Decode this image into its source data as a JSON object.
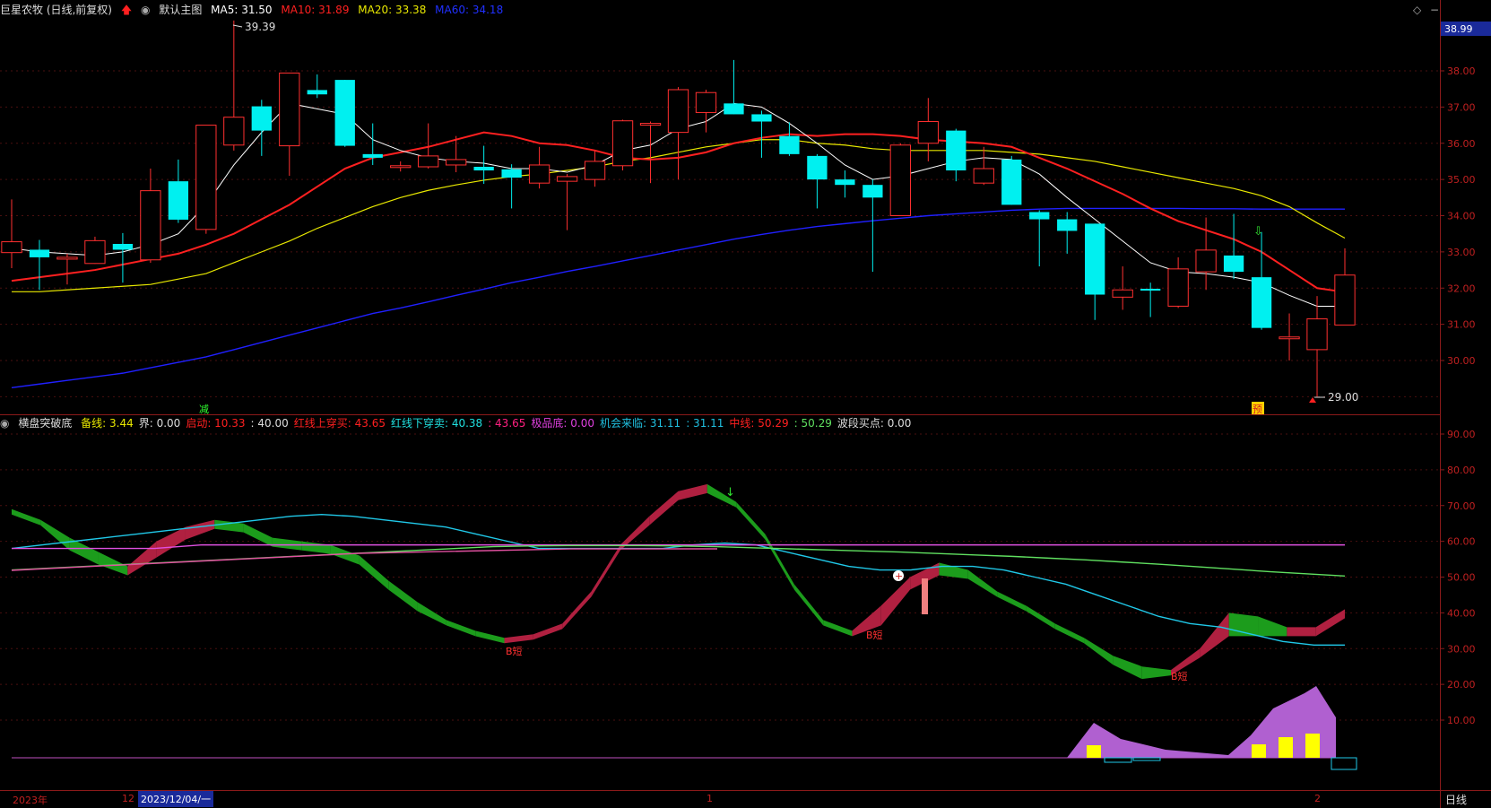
{
  "header": {
    "stock_name": "巨星农牧 (日线,前复权)",
    "up_arrow": "arrow-up-icon",
    "main_chart_label": "默认主图",
    "ma5": "MA5: 31.50",
    "ma10": "MA10: 31.89",
    "ma20": "MA20: 33.38",
    "ma60": "MA60: 34.18",
    "colors": {
      "ma5": "#ffffff",
      "ma10": "#ff2020",
      "ma20": "#e8e800",
      "ma60": "#2020ff"
    }
  },
  "indicator_header": {
    "name": "横盘突破底",
    "items": [
      {
        "text": "备线: 3.44",
        "color": "#e8e800"
      },
      {
        "text": "界: 0.00",
        "color": "#dddddd"
      },
      {
        "text": "启动: 10.33",
        "color": "#ff2020"
      },
      {
        "text": ": 40.00",
        "color": "#dddddd"
      },
      {
        "text": "红线上穿买: 43.65",
        "color": "#ff2020"
      },
      {
        "text": "红线下穿卖: 40.38",
        "color": "#20e0e0"
      },
      {
        "text": ": 43.65",
        "color": "#ff2080"
      },
      {
        "text": "极品底: 0.00",
        "color": "#e040e0"
      },
      {
        "text": "机会来临: 31.11",
        "color": "#20c0e0"
      },
      {
        "text": ": 31.11",
        "color": "#20c0e0"
      },
      {
        "text": "中线: 50.29",
        "color": "#ff2020"
      },
      {
        "text": ": 50.29",
        "color": "#60e060"
      },
      {
        "text": "波段买点: 0.00",
        "color": "#dddddd"
      }
    ]
  },
  "price_axis": {
    "current_price": "38.99",
    "ticks": [
      "38.00",
      "37.00",
      "36.00",
      "35.00",
      "34.00",
      "33.00",
      "32.00",
      "31.00",
      "30.00"
    ]
  },
  "indicator_axis": {
    "ticks": [
      "90.00",
      "80.00",
      "70.00",
      "60.00",
      "50.00",
      "40.00",
      "30.00",
      "20.00",
      "10.00"
    ]
  },
  "annotations": {
    "high": "39.39",
    "low": "29.00",
    "mark_jian": "减",
    "mark_yu": "预",
    "b_short": "B短"
  },
  "bottom_bar": {
    "year": "2023年",
    "m12": "12",
    "date": "2023/12/04/一",
    "m1": "1",
    "m2": "2",
    "period": "日线"
  },
  "chart_data": {
    "type": "candlestick",
    "ylim": [
      29.0,
      39.39
    ],
    "candles": [
      {
        "o": 32.98,
        "h": 34.45,
        "l": 32.55,
        "c": 33.28
      },
      {
        "o": 33.06,
        "h": 33.33,
        "l": 31.95,
        "c": 32.85
      },
      {
        "o": 32.85,
        "h": 32.95,
        "l": 32.1,
        "c": 32.85
      },
      {
        "o": 32.68,
        "h": 33.42,
        "l": 32.67,
        "c": 33.31
      },
      {
        "o": 33.22,
        "h": 33.52,
        "l": 32.15,
        "c": 33.06
      },
      {
        "o": 32.78,
        "h": 35.3,
        "l": 32.7,
        "c": 34.69
      },
      {
        "o": 34.95,
        "h": 35.55,
        "l": 33.8,
        "c": 33.89
      },
      {
        "o": 33.62,
        "h": 36.5,
        "l": 33.5,
        "c": 36.5
      },
      {
        "o": 35.95,
        "h": 39.39,
        "l": 35.8,
        "c": 36.72
      },
      {
        "o": 37.02,
        "h": 37.2,
        "l": 35.65,
        "c": 36.35
      },
      {
        "o": 35.93,
        "h": 37.95,
        "l": 35.1,
        "c": 37.94
      },
      {
        "o": 37.47,
        "h": 37.9,
        "l": 37.25,
        "c": 37.35
      },
      {
        "o": 37.75,
        "h": 37.75,
        "l": 35.9,
        "c": 35.93
      },
      {
        "o": 35.7,
        "h": 36.55,
        "l": 35.4,
        "c": 35.6
      },
      {
        "o": 35.38,
        "h": 35.5,
        "l": 35.22,
        "c": 35.38
      },
      {
        "o": 35.35,
        "h": 36.55,
        "l": 35.3,
        "c": 35.65
      },
      {
        "o": 35.4,
        "h": 36.2,
        "l": 35.2,
        "c": 35.55
      },
      {
        "o": 35.35,
        "h": 35.93,
        "l": 34.88,
        "c": 35.25
      },
      {
        "o": 35.28,
        "h": 35.42,
        "l": 34.2,
        "c": 35.05
      },
      {
        "o": 34.9,
        "h": 35.9,
        "l": 34.75,
        "c": 35.4
      },
      {
        "o": 34.95,
        "h": 35.15,
        "l": 33.6,
        "c": 35.08
      },
      {
        "o": 35.0,
        "h": 35.8,
        "l": 34.8,
        "c": 35.5
      },
      {
        "o": 35.38,
        "h": 36.65,
        "l": 35.25,
        "c": 36.62
      },
      {
        "o": 36.5,
        "h": 36.6,
        "l": 34.9,
        "c": 36.55
      },
      {
        "o": 36.3,
        "h": 37.55,
        "l": 35.0,
        "c": 37.48
      },
      {
        "o": 36.85,
        "h": 37.48,
        "l": 36.3,
        "c": 37.4
      },
      {
        "o": 37.1,
        "h": 38.3,
        "l": 36.8,
        "c": 36.8
      },
      {
        "o": 36.8,
        "h": 36.9,
        "l": 35.6,
        "c": 36.6
      },
      {
        "o": 36.2,
        "h": 36.58,
        "l": 35.65,
        "c": 35.7
      },
      {
        "o": 35.65,
        "h": 35.7,
        "l": 34.2,
        "c": 35.0
      },
      {
        "o": 35.0,
        "h": 35.25,
        "l": 34.5,
        "c": 34.85
      },
      {
        "o": 34.85,
        "h": 35.0,
        "l": 32.45,
        "c": 34.5
      },
      {
        "o": 34.0,
        "h": 36.0,
        "l": 34.0,
        "c": 35.95
      },
      {
        "o": 36.0,
        "h": 37.25,
        "l": 35.5,
        "c": 36.6
      },
      {
        "o": 36.35,
        "h": 36.4,
        "l": 34.95,
        "c": 35.25
      },
      {
        "o": 34.9,
        "h": 35.9,
        "l": 34.85,
        "c": 35.3
      },
      {
        "o": 35.55,
        "h": 35.65,
        "l": 34.3,
        "c": 34.3
      },
      {
        "o": 34.1,
        "h": 34.15,
        "l": 32.6,
        "c": 33.9
      },
      {
        "o": 33.9,
        "h": 34.1,
        "l": 32.95,
        "c": 33.58
      },
      {
        "o": 33.78,
        "h": 33.78,
        "l": 31.12,
        "c": 31.82
      },
      {
        "o": 31.75,
        "h": 32.6,
        "l": 31.4,
        "c": 31.95
      },
      {
        "o": 31.98,
        "h": 32.15,
        "l": 31.2,
        "c": 31.95
      },
      {
        "o": 31.5,
        "h": 32.85,
        "l": 31.45,
        "c": 32.53
      },
      {
        "o": 32.45,
        "h": 33.95,
        "l": 31.95,
        "c": 33.05
      },
      {
        "o": 32.9,
        "h": 34.05,
        "l": 32.25,
        "c": 32.45
      },
      {
        "o": 32.3,
        "h": 33.55,
        "l": 30.85,
        "c": 30.9
      },
      {
        "o": 30.65,
        "h": 31.3,
        "l": 30.0,
        "c": 30.65
      },
      {
        "o": 30.3,
        "h": 31.78,
        "l": 29.0,
        "c": 31.15
      },
      {
        "o": 30.98,
        "h": 33.1,
        "l": 30.98,
        "c": 32.36
      }
    ],
    "ma5": [
      33.1,
      33.0,
      32.95,
      32.9,
      33.0,
      33.2,
      33.5,
      34.3,
      35.4,
      36.3,
      37.1,
      36.95,
      36.8,
      36.1,
      35.8,
      35.6,
      35.5,
      35.45,
      35.3,
      35.3,
      35.2,
      35.4,
      35.8,
      35.95,
      36.4,
      36.6,
      37.1,
      37.0,
      36.55,
      36.0,
      35.4,
      35.0,
      35.1,
      35.3,
      35.5,
      35.6,
      35.55,
      35.15,
      34.5,
      33.9,
      33.3,
      32.7,
      32.45,
      32.4,
      32.3,
      32.15,
      31.8,
      31.5,
      31.5
    ],
    "ma10": [
      32.2,
      32.3,
      32.4,
      32.5,
      32.65,
      32.8,
      32.95,
      33.2,
      33.5,
      33.9,
      34.3,
      34.8,
      35.3,
      35.6,
      35.75,
      35.9,
      36.1,
      36.3,
      36.2,
      36.0,
      35.95,
      35.8,
      35.6,
      35.55,
      35.6,
      35.75,
      36.0,
      36.15,
      36.25,
      36.2,
      36.25,
      36.25,
      36.2,
      36.1,
      36.05,
      36.0,
      35.9,
      35.6,
      35.3,
      34.95,
      34.6,
      34.2,
      33.85,
      33.6,
      33.35,
      33.0,
      32.5,
      32.0,
      31.89
    ],
    "ma20": [
      31.9,
      31.9,
      31.95,
      32.0,
      32.05,
      32.1,
      32.25,
      32.4,
      32.7,
      33.0,
      33.3,
      33.65,
      33.95,
      34.25,
      34.5,
      34.7,
      34.85,
      34.98,
      35.08,
      35.15,
      35.25,
      35.35,
      35.5,
      35.6,
      35.75,
      35.9,
      36.0,
      36.1,
      36.1,
      36.0,
      35.95,
      35.85,
      35.8,
      35.8,
      35.8,
      35.8,
      35.75,
      35.7,
      35.6,
      35.5,
      35.35,
      35.2,
      35.05,
      34.9,
      34.75,
      34.55,
      34.25,
      33.8,
      33.38
    ],
    "ma60": [
      29.25,
      29.35,
      29.45,
      29.55,
      29.65,
      29.8,
      29.95,
      30.1,
      30.3,
      30.5,
      30.7,
      30.9,
      31.1,
      31.3,
      31.45,
      31.62,
      31.8,
      31.97,
      32.15,
      32.3,
      32.46,
      32.6,
      32.75,
      32.9,
      33.05,
      33.2,
      33.35,
      33.48,
      33.6,
      33.7,
      33.78,
      33.86,
      33.93,
      34.0,
      34.05,
      34.1,
      34.15,
      34.18,
      34.2,
      34.2,
      34.2,
      34.2,
      34.2,
      34.19,
      34.19,
      34.18,
      34.18,
      34.18,
      34.18
    ],
    "indicator_red_line": [
      69,
      66,
      61,
      57,
      53,
      60,
      64,
      66,
      65,
      61,
      60,
      59,
      56,
      49,
      43,
      38,
      35,
      33,
      34,
      37,
      46,
      59,
      67,
      74,
      76,
      71,
      62,
      48,
      38,
      35,
      42,
      50,
      54,
      52,
      46,
      42,
      37,
      33,
      28,
      25,
      24,
      30,
      40,
      39,
      36,
      36,
      41
    ],
    "indicator_green_line": [
      69,
      66,
      59,
      55,
      52,
      57,
      62,
      65,
      64,
      60,
      59,
      58,
      55,
      48,
      42,
      38,
      35,
      33,
      34,
      37,
      46,
      59,
      66,
      73,
      75,
      71,
      62,
      48,
      38,
      35,
      38,
      48,
      52,
      51,
      46,
      42,
      37,
      33,
      27,
      23,
      24,
      29,
      35,
      35,
      35,
      35,
      40
    ],
    "indicator_cyan_line": [
      58,
      59,
      60,
      61,
      62,
      63,
      64,
      65,
      66,
      67,
      67.5,
      67,
      66,
      65,
      64,
      62,
      60,
      58,
      58,
      58,
      58,
      58,
      59,
      59.5,
      59,
      57,
      55,
      53,
      52,
      52,
      53,
      53,
      52,
      50,
      48,
      45,
      42,
      39,
      37,
      36,
      34,
      32,
      31,
      31
    ],
    "indicator_magenta_line": [
      58,
      58,
      58,
      58,
      59,
      59,
      59,
      59,
      59,
      59,
      59,
      59,
      59,
      59,
      59,
      59,
      59,
      59,
      59,
      59,
      59,
      59,
      59,
      59,
      59,
      59,
      59,
      59,
      59
    ],
    "indicator_midline": [
      52,
      52.5,
      53,
      53.5,
      54,
      54.5,
      55,
      55.5,
      56,
      56.5,
      57,
      57.5,
      58,
      58.5,
      58.7,
      58.8,
      58.8,
      58.8,
      58.7,
      58.5,
      58.2,
      57.9,
      57.6,
      57.3,
      57.0,
      56.6,
      56.2,
      55.8,
      55.3,
      54.8,
      54.2,
      53.6,
      52.9,
      52.2,
      51.5,
      50.9,
      50.29
    ]
  }
}
